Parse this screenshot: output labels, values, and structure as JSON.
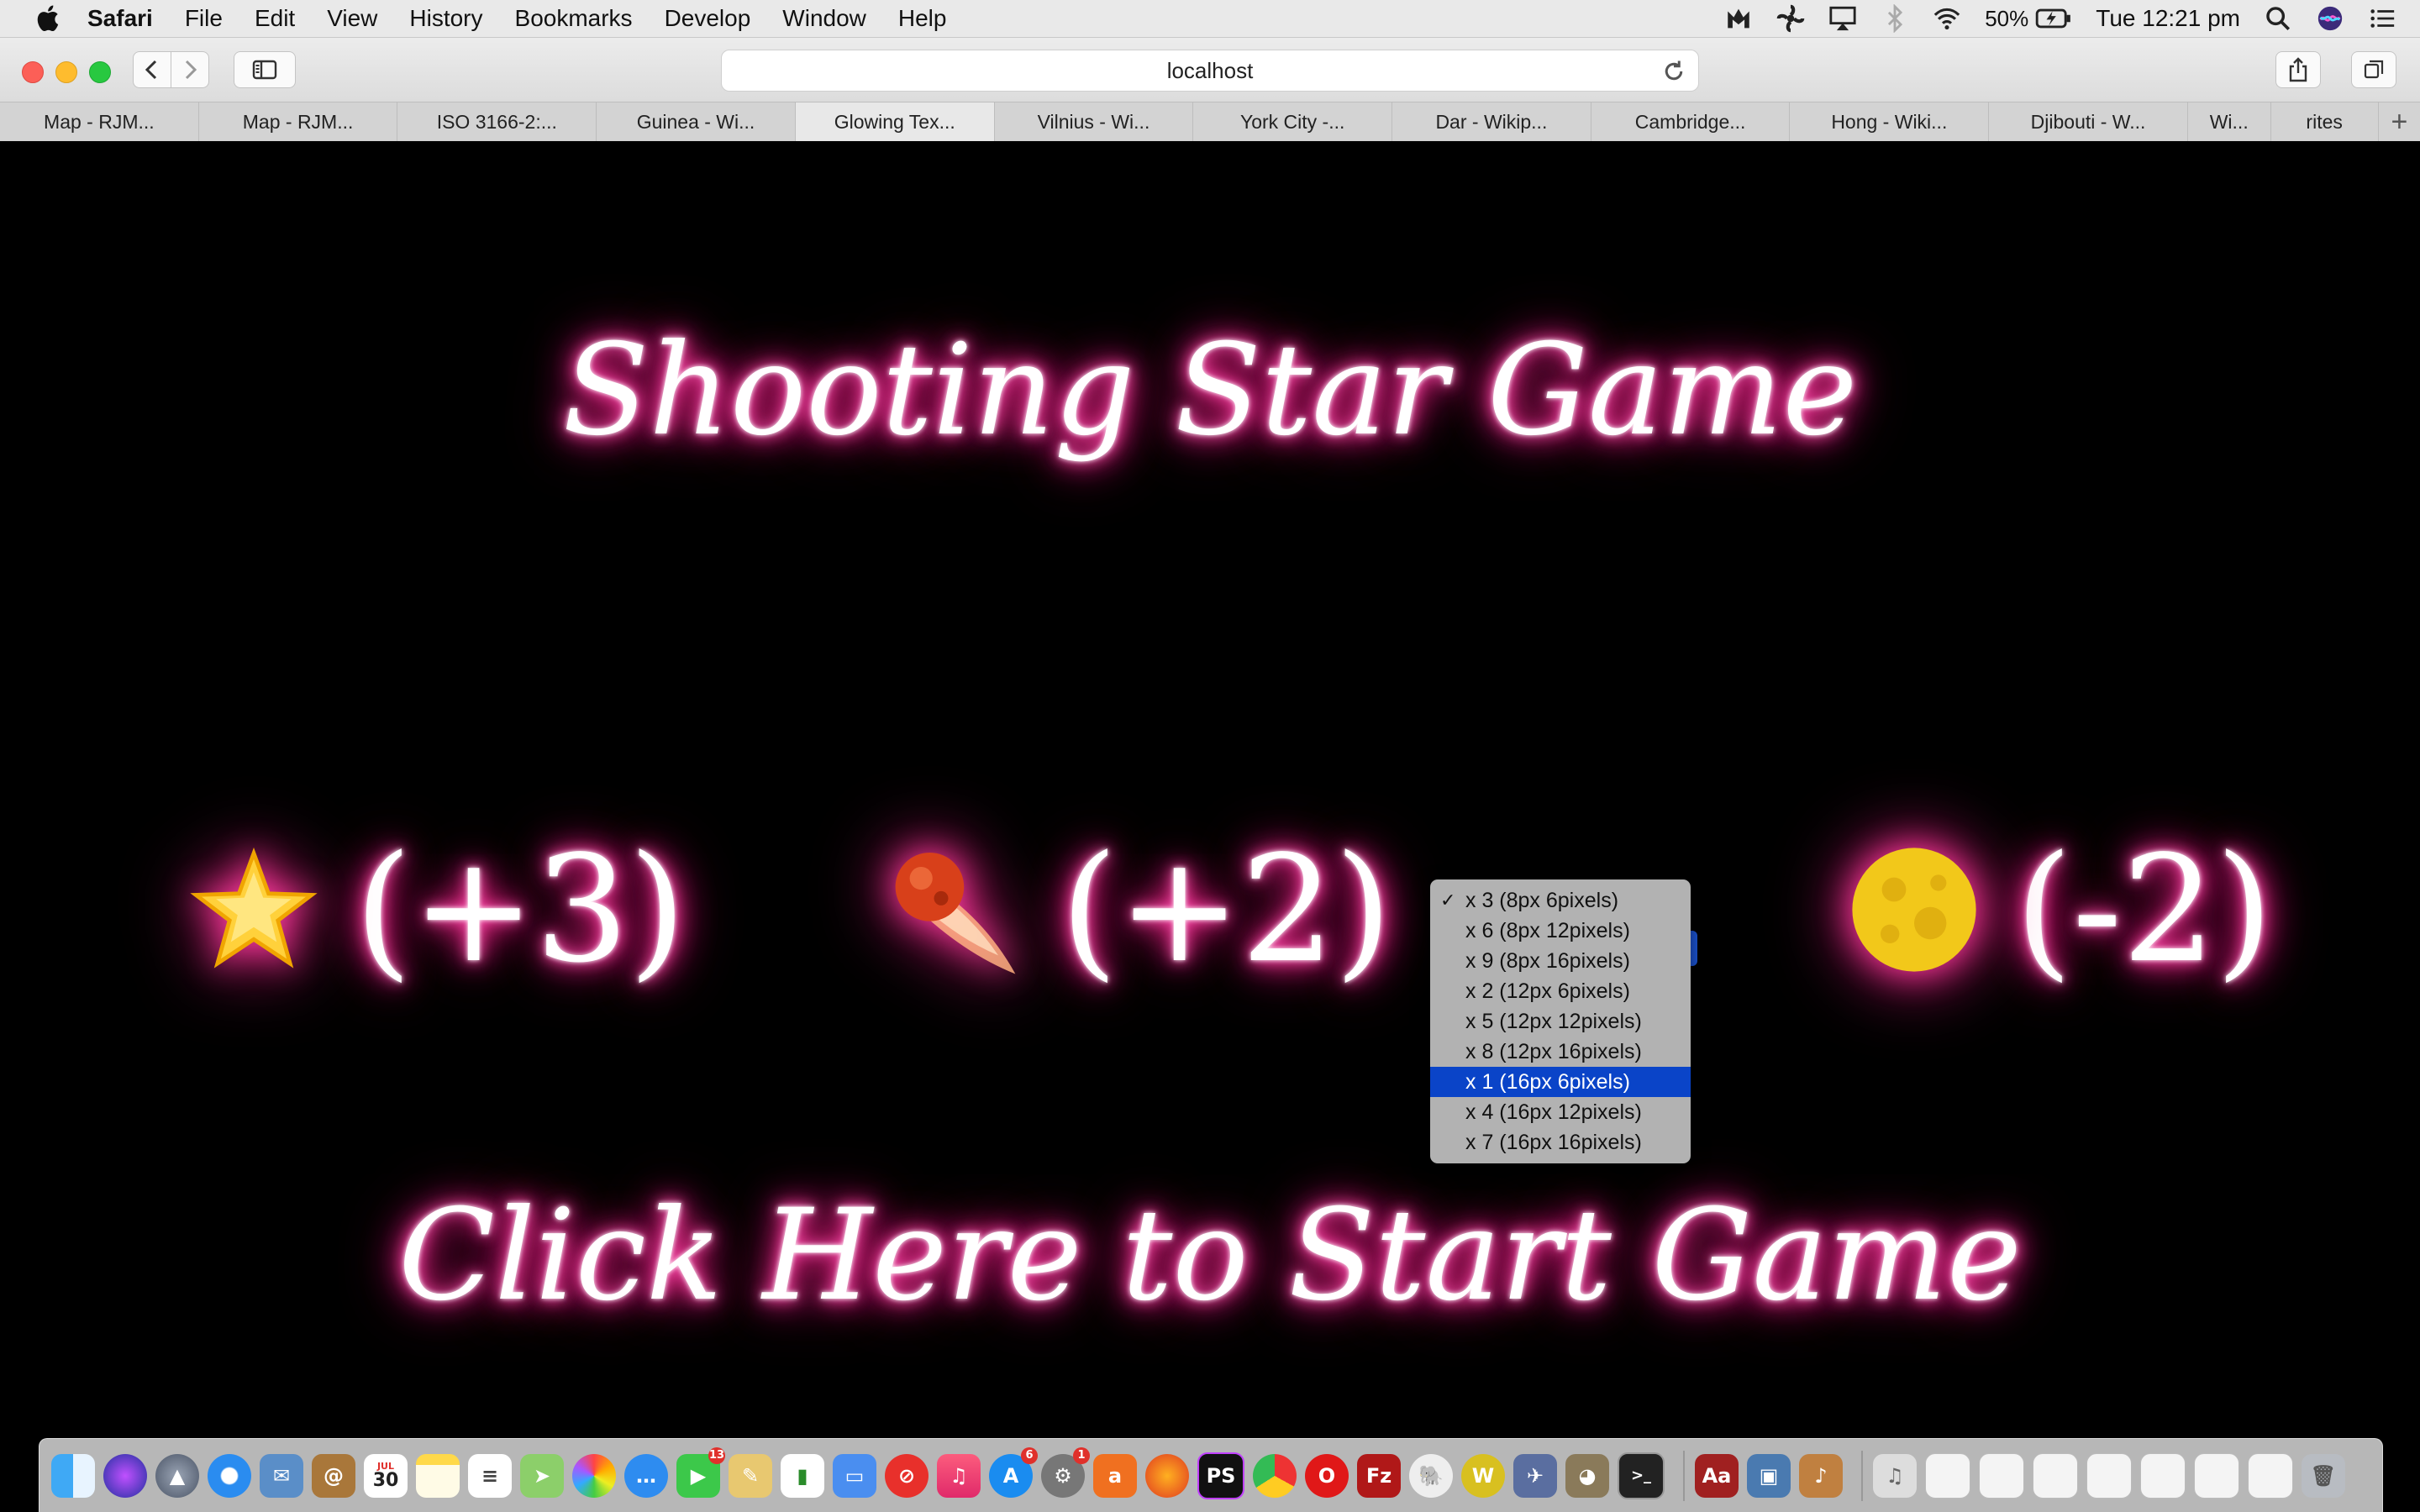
{
  "menubar": {
    "app_name": "Safari",
    "menus": [
      "File",
      "Edit",
      "View",
      "History",
      "Bookmarks",
      "Develop",
      "Window",
      "Help"
    ],
    "battery": "50%",
    "clock": "Tue 12:21 pm"
  },
  "toolbar": {
    "address": "localhost"
  },
  "tabs": [
    {
      "label": "Map - RJM..."
    },
    {
      "label": "Map - RJM..."
    },
    {
      "label": "ISO 3166-2:..."
    },
    {
      "label": "Guinea - Wi..."
    },
    {
      "label": "Glowing Tex..."
    },
    {
      "label": "Vilnius - Wi..."
    },
    {
      "label": "York City -..."
    },
    {
      "label": "Dar - Wikip..."
    },
    {
      "label": "Cambridge..."
    },
    {
      "label": "Hong - Wiki..."
    },
    {
      "label": "Djibouti - W..."
    },
    {
      "label": "Wi..."
    },
    {
      "label": "rites"
    }
  ],
  "game": {
    "title": "Shooting Star Game",
    "scores": {
      "star": "(+3)",
      "comet": "(+2)",
      "moon": "(-2)"
    },
    "start_label": "Click Here to Start Game"
  },
  "popup": {
    "options": [
      {
        "label": "x 3 (8px 6pixels)",
        "checked": true
      },
      {
        "label": "x 6 (8px 12pixels)"
      },
      {
        "label": "x 9 (8px 16pixels)"
      },
      {
        "label": "x 2 (12px 6pixels)"
      },
      {
        "label": "x 5 (12px 12pixels)"
      },
      {
        "label": "x 8 (12px 16pixels)"
      },
      {
        "label": "x 1 (16px 6pixels)",
        "highlighted": true
      },
      {
        "label": "x 4 (16px 12pixels)"
      },
      {
        "label": "x 7 (16px 16pixels)"
      }
    ],
    "check_mark": "✓"
  },
  "dock": {
    "calendar_day": "30",
    "calendar_month": "JUL",
    "messages_badge": "13",
    "appstore_badge": "6",
    "settings_badge": "1"
  },
  "colors": {
    "glow_pink": "#ff2d95",
    "selection_blue": "#0a44c8",
    "page_background": "#000000"
  }
}
